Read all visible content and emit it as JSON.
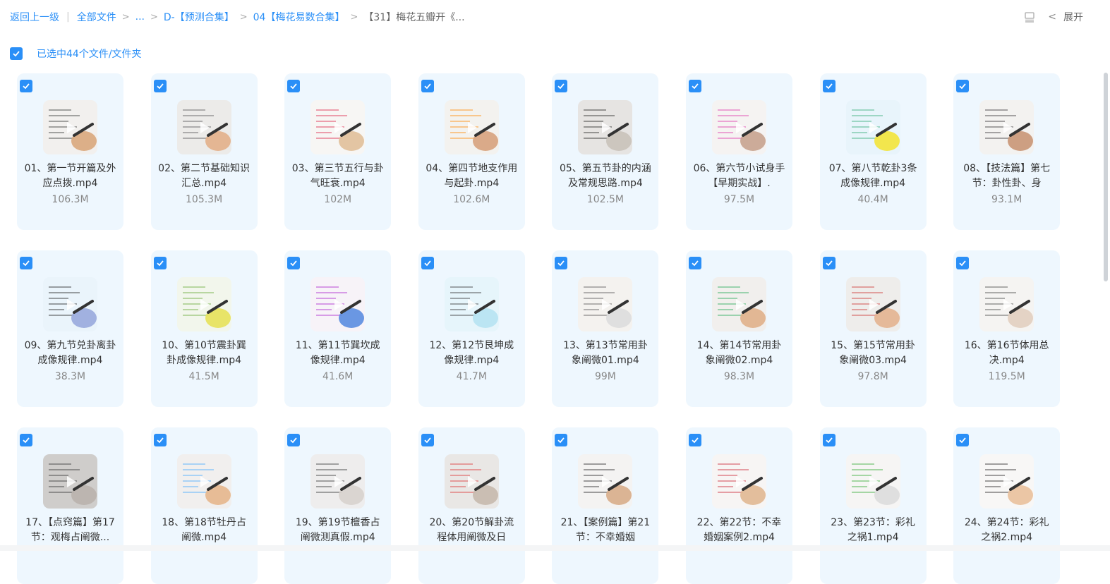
{
  "breadcrumb": {
    "back": "返回上一级",
    "all_files": "全部文件",
    "ellipsis": "...",
    "level1": "D-【预测合集】",
    "level2": "04【梅花易数合集】",
    "current": "【31】梅花五瓣开《..."
  },
  "toolbar": {
    "list_icon": "list-view-icon",
    "expand_label": "展开"
  },
  "selection": {
    "label": "已选中44个文件/文件夹"
  },
  "colors": {
    "accent": "#2a8ff7",
    "card_bg": "#eef7fe"
  },
  "files": [
    {
      "name": "01、第一节开篇及外应点拨.mp4",
      "size": "106.3M"
    },
    {
      "name": "02、第二节基础知识汇总.mp4",
      "size": "105.3M"
    },
    {
      "name": "03、第三节五行与卦气旺衰.mp4",
      "size": "102M"
    },
    {
      "name": "04、第四节地支作用与起卦.mp4",
      "size": "102.6M"
    },
    {
      "name": "05、第五节卦的内涵及常规思路.mp4",
      "size": "102.5M"
    },
    {
      "name": "06、第六节小试身手【早期实战】.",
      "size": "97.5M"
    },
    {
      "name": "07、第八节乾卦3条成像规律.mp4",
      "size": "40.4M"
    },
    {
      "name": "08、【技法篇】第七节：卦性卦、身",
      "size": "93.1M"
    },
    {
      "name": "09、第九节兑卦离卦成像规律.mp4",
      "size": "38.3M"
    },
    {
      "name": "10、第10节震卦巽卦成像规律.mp4",
      "size": "41.5M"
    },
    {
      "name": "11、第11节巽坎成像规律.mp4",
      "size": "41.6M"
    },
    {
      "name": "12、第12节艮坤成像规律.mp4",
      "size": "41.7M"
    },
    {
      "name": "13、第13节常用卦象阐微01.mp4",
      "size": "99M"
    },
    {
      "name": "14、第14节常用卦象阐微02.mp4",
      "size": "98.3M"
    },
    {
      "name": "15、第15节常用卦象阐微03.mp4",
      "size": "97.8M"
    },
    {
      "name": "16、第16节体用总决.mp4",
      "size": "119.5M"
    },
    {
      "name": "17、【点窍篇】第17节：观梅占阐微...",
      "size": ""
    },
    {
      "name": "18、第18节牡丹占阐微.mp4",
      "size": ""
    },
    {
      "name": "19、第19节檀香占阐微测真假.mp4",
      "size": ""
    },
    {
      "name": "20、第20节解卦流程体用阐微及日",
      "size": ""
    },
    {
      "name": "21、【案例篇】第21节：不幸婚姻",
      "size": ""
    },
    {
      "name": "22、第22节：不幸婚姻案例2.mp4",
      "size": ""
    },
    {
      "name": "23、第23节：彩礼之祸1.mp4",
      "size": ""
    },
    {
      "name": "24、第24节：彩礼之祸2.mp4",
      "size": ""
    }
  ]
}
